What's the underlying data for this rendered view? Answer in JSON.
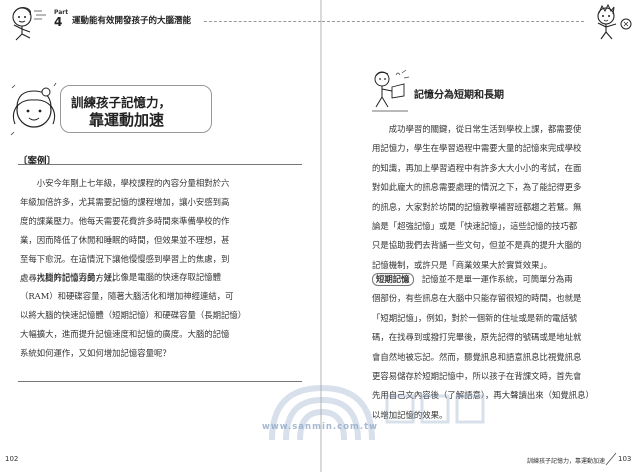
{
  "header": {
    "part_label": "Part",
    "part_number": "4",
    "title": "運動能有效開發孩子的大腦潛能"
  },
  "left_page": {
    "title_line1": "訓練孩子記憶力，",
    "title_line2": "靠運動加速",
    "case_label": "〔案例〕",
    "case_para1": [
      "　　小安今年剛上七年級，學校課程的內容分量相對於六",
      "年級加倍許多，尤其需要記憶的課程增加，讓小安感到高",
      "度的課業壓力。他每天需要花費許多時間來準備學校的作",
      "業，因而降低了休閒和睡眠的時間，但效果並不理想，甚",
      "至每下愈況。在這情況下讓他慢慢感到學習上的焦慮，到",
      "處尋找提升記憶力的方法。"
    ],
    "case_para2": [
      "　　大腦的記憶容量，好比像是電腦的快速存取記憶體",
      "（RAM）和硬碟容量，隨著大腦活化和增加神經連結，可",
      "以將大腦的快速記憶體（短期記憶）和硬碟容量（長期記憶）",
      "大幅擴大，進而提升記憶速度和記憶的廣度。大腦的記憶",
      "系統如何運作，又如何增加記憶容量呢？"
    ],
    "page_number": "102"
  },
  "right_page": {
    "subtitle": "記憶分為短期和長期",
    "para1": [
      "　　成功學習的關鍵，從日常生活到學校上課，都需要使",
      "用記憶力，學生在學習過程中需要大量的記憶來完成學校",
      "的知識，再加上學習過程中有許多大大小小的考試，在面",
      "對如此龐大的訊息需要處理的情況之下，為了能記得更多",
      "的訊息，大家對於坊間的記憶教學補習班都趨之若鶩。無",
      "論是「超強記憶」或是「快速記憶」，這些記憶的技巧都",
      "只是協助我們去背誦一些文句，但並不是真的提升大腦的",
      "記憶機制，或許只是「商業效果大於實質效果」。"
    ],
    "short_term_badge": "短期記憶",
    "para2_first_rest": "　記憶並不是單一運作系統，可簡單分為兩",
    "para2": [
      "個部份，有些訊息在大腦中只能存留很短的時間，也就是",
      "「短期記憶」，例如，對於一個新的住址或是新的電話號",
      "碼，在找尋到或撥打完畢後，原先記得的號碼或是地址就",
      "會自然地被忘記。然而，聽覺訊息和語意訊息比視覺訊息",
      "更容易儲存於短期記憶中，所以孩子在背課文時，首先會",
      "先用自己文內容後（了解語意），再大聲讀出來（知覺訊息）",
      "以增加記憶的效果。"
    ],
    "footer_text": "訓練孩子記憶力，靠運動加速",
    "page_number": "103"
  },
  "watermark": {
    "text": "www.sanmin.com.tw"
  },
  "colors": {
    "watermark": "#8fa8c8",
    "rule": "#777777"
  }
}
